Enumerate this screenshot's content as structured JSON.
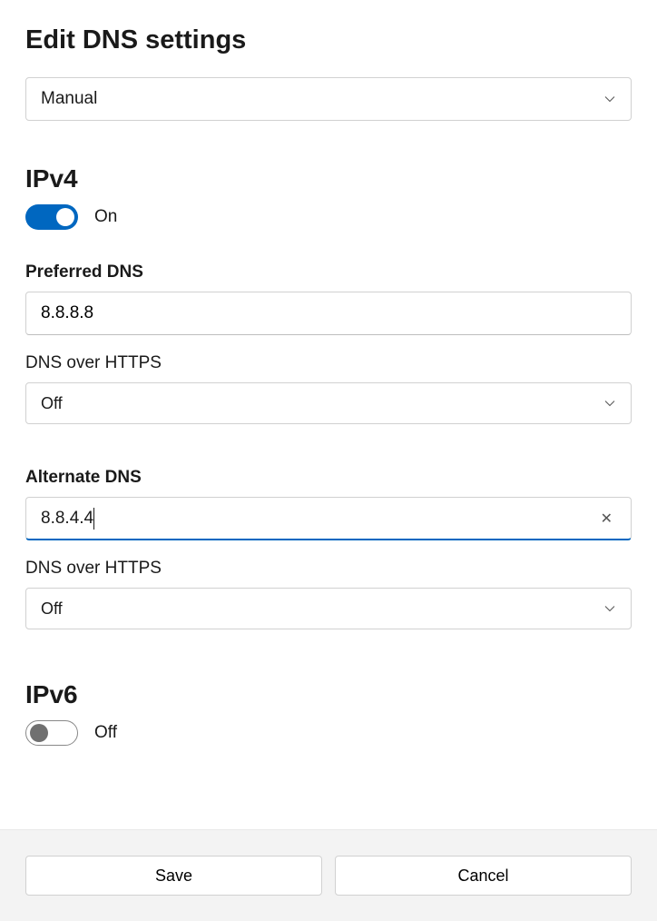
{
  "pageTitle": "Edit DNS settings",
  "modeDropdown": {
    "value": "Manual"
  },
  "ipv4": {
    "sectionLabel": "IPv4",
    "toggle": {
      "state": "on",
      "label": "On"
    },
    "preferred": {
      "label": "Preferred DNS",
      "value": "8.8.8.8"
    },
    "dohPreferred": {
      "label": "DNS over HTTPS",
      "value": "Off"
    },
    "alternate": {
      "label": "Alternate DNS",
      "value": "8.8.4.4"
    },
    "dohAlternate": {
      "label": "DNS over HTTPS",
      "value": "Off"
    }
  },
  "ipv6": {
    "sectionLabel": "IPv6",
    "toggle": {
      "state": "off",
      "label": "Off"
    }
  },
  "footer": {
    "save": "Save",
    "cancel": "Cancel"
  }
}
